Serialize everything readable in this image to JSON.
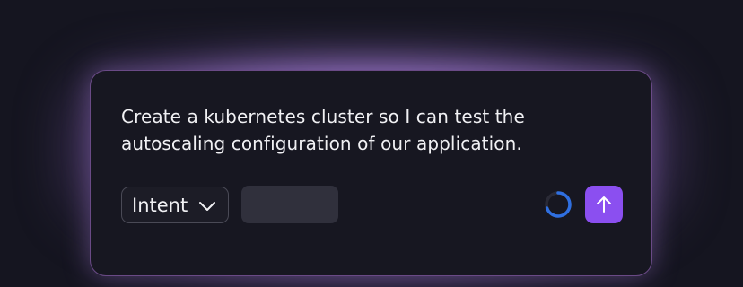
{
  "composer": {
    "prompt_text": "Create a kubernetes cluster so I can test the autoscaling configuration of our application.",
    "mode_selector": {
      "label": "Intent",
      "icon": "chevron-down-icon"
    },
    "blank_button": {
      "label": ""
    },
    "status_icon": "loading-spinner-icon",
    "send_button": {
      "icon": "arrow-up-icon"
    }
  },
  "colors": {
    "background": "#151520",
    "panel": "#171721",
    "glow": "#a07fc8",
    "accent": "#8b4ff0",
    "spinner_active": "#2f6fe0",
    "spinner_track": "#2a2a36"
  }
}
